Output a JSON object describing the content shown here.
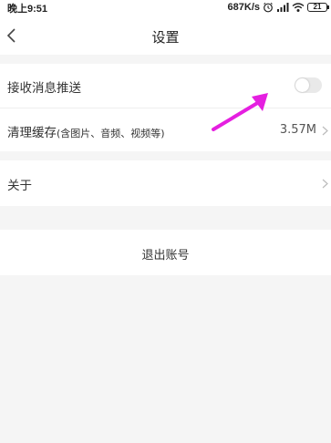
{
  "status_bar": {
    "time": "晚上9:51",
    "network_speed": "687K/s",
    "battery": "21",
    "icons": [
      "alarm-icon",
      "signal-icon",
      "wifi-icon",
      "battery-icon"
    ]
  },
  "nav": {
    "title": "设置",
    "back_icon": "chevron-left-icon"
  },
  "settings": {
    "push": {
      "label": "接收消息推送",
      "enabled": false
    },
    "cache": {
      "label": "清理缓存",
      "sublabel": "(含图片、音频、视频等)",
      "value": "3.57M"
    },
    "about": {
      "label": "关于"
    },
    "logout": {
      "label": "退出账号"
    }
  },
  "colors": {
    "background": "#f5f5f5",
    "card": "#ffffff",
    "annotation_arrow": "#e51fe0",
    "toggle_off": "#e9e9e9"
  }
}
